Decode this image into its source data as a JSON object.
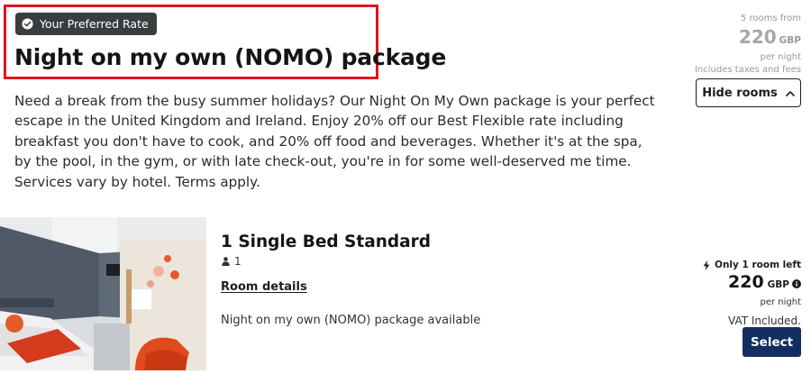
{
  "offer": {
    "badge_label": "Your Preferred Rate",
    "title": "Night on my own (NOMO) package",
    "description": "Need a break from the busy summer holidays? Our Night On My Own package is your perfect escape in the United Kingdom and Ireland. Enjoy 20% off our Best Flexible rate including breakfast you don't have to cook, and 20% off food and beverages. Whether it's at the spa, by the pool, in the gym, or with late check-out, you're in for some well-deserved me time. Services vary by hotel. Terms apply."
  },
  "price_summary": {
    "rooms_from": "5 rooms from",
    "amount": "220",
    "currency": "GBP",
    "per_night": "per night",
    "taxes_note": "Includes taxes and fees"
  },
  "toggle": {
    "hide_rooms_label": "Hide rooms",
    "icon": "chevron-up-icon"
  },
  "room": {
    "name": "1 Single Bed Standard",
    "occupancy": "1",
    "details_link": "Room details",
    "availability_note": "Night on my own (NOMO) package available",
    "availability_alert": "Only 1 room left",
    "price": "220",
    "currency": "GBP",
    "per_night": "per night",
    "vat_note": "VAT Included.",
    "select_label": "Select"
  },
  "colors": {
    "badge_bg": "#3a3d3f",
    "highlight_border": "#e1141e",
    "select_button_bg": "#132e5e",
    "muted_text": "#9a9a9a"
  }
}
